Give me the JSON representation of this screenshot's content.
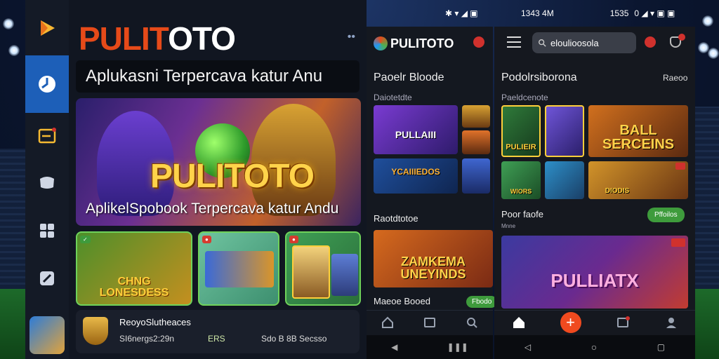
{
  "app": {
    "brand_pre": "PULIT",
    "brand_o": "O",
    "brand_post": "TO",
    "tagline": "Aplukasni Terpercava katur Anu",
    "hero_logo": "PULITOTO",
    "hero_caption": "AplikelSpobook Terpercava katur Andu",
    "tiles": [
      {
        "label_line1": "CHNG",
        "label_line2": "LONESDESS"
      },
      {
        "label_line1": "",
        "label_line2": ""
      },
      {
        "label_line1": "",
        "label_line2": ""
      }
    ],
    "promo": {
      "title": "ReoyoSlutheaces",
      "line": "SI6nergs2:29n",
      "tag": "ERS",
      "extra": "Sdo B 8B Secsso"
    }
  },
  "phone_mid": {
    "status_icons": "✱ ▾ ◢ ▣",
    "brand": "PULITOTO",
    "section1": "Paoelr Bloode",
    "sub1": "Daiotetdte",
    "game1": "PULLAIII",
    "game2": "YCAIIIEDOS",
    "section2": "Raotdtotoe",
    "game3": "ZAMKEMA",
    "game3b": "UNEYINDS",
    "section3": "Maeoe Booed",
    "pill": "Fbodo"
  },
  "phone_right": {
    "time_left": "1343 4M",
    "time_right": "1535",
    "status_icons": "0 ◢ ▾ ▣ ▣",
    "search_value": "eloulioosola",
    "section1": "Podolrsiborona",
    "section1_action": "Raeoo",
    "sub1": "Paeldcenote",
    "game1": "PULIEIR",
    "game2": "BALL",
    "game2b": "SERCEINS",
    "game3": "WIORS",
    "game4": "DIODIS",
    "section2": "Poor faofe",
    "sub2": "Mnne",
    "pill": "Pffoilos",
    "game5": "PULLIATX",
    "fab_symbol": "+"
  },
  "colors": {
    "accent_orange": "#e64a19",
    "rail_active": "#1d5fb8",
    "green": "#3e9b3c",
    "red_badge": "#d0312d"
  }
}
